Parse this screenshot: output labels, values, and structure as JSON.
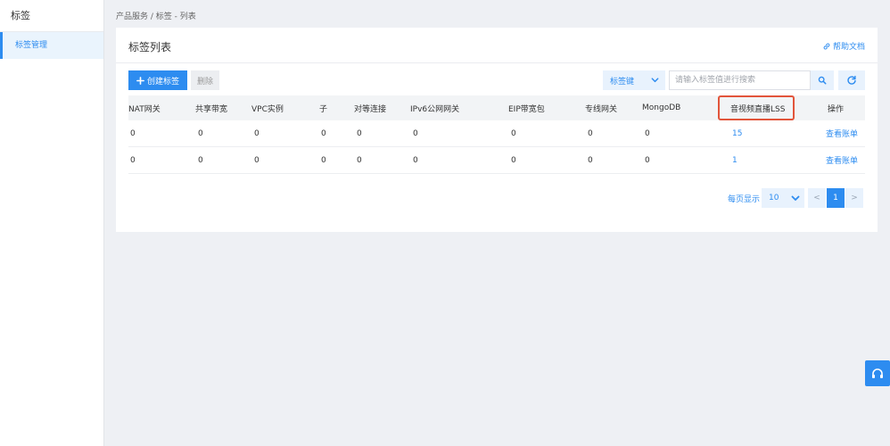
{
  "sidebar": {
    "title": "标签",
    "items": [
      {
        "label": "标签管理",
        "active": true
      }
    ]
  },
  "breadcrumb": "产品服务 / 标签 - 列表",
  "card": {
    "title": "标签列表",
    "help_label": "帮助文档"
  },
  "toolbar": {
    "create_label": "创建标签",
    "delete_label": "删除",
    "tag_select_value": "标签键",
    "search_placeholder": "请输入标签值进行搜索"
  },
  "table": {
    "columns": [
      "NAT网关",
      "共享带宽",
      "VPC实例",
      "子",
      "对等连接",
      "IPv6公网网关",
      "EIP带宽包",
      "专线网关",
      "MongoDB",
      "音视频直播LSS",
      "操作"
    ],
    "rows": [
      [
        "0",
        "0",
        "0",
        "0",
        "0",
        "0",
        "0",
        "0",
        "0",
        "15",
        "查看账单"
      ],
      [
        "0",
        "0",
        "0",
        "0",
        "0",
        "0",
        "0",
        "0",
        "0",
        "1",
        "查看账单"
      ]
    ],
    "highlighted_column": "音视频直播LSS"
  },
  "pagination": {
    "per_page_label": "每页显示",
    "per_page_value": "10",
    "prev_label": "<",
    "current_page": "1",
    "next_label": ">"
  },
  "icons": {
    "create": "plus-icon",
    "help": "link-icon",
    "search": "search-icon",
    "refresh": "refresh-icon",
    "support": "headset-icon"
  },
  "colors": {
    "primary": "#2d8cf0",
    "highlight_border": "#e2553b",
    "page_bg": "#eef0f4",
    "header_row_bg": "#f2f4f6"
  }
}
